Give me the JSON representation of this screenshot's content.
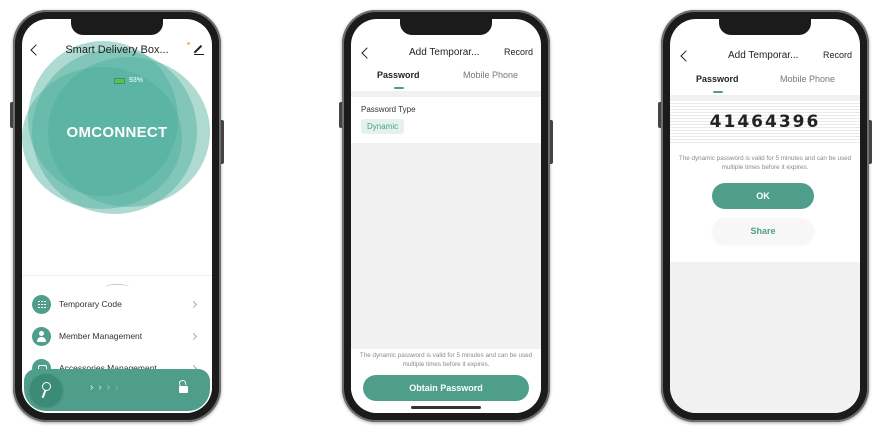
{
  "colors": {
    "accent": "#4f9e8c",
    "chip_bg": "#e4f1ed",
    "gray_bg": "#f1f1f1",
    "battery": "#58c23a"
  },
  "phone1": {
    "title": "Smart Delivery Box...",
    "battery_level": "93%",
    "brand": "OMCONNECT",
    "menu": [
      {
        "label": "Temporary Code",
        "icon": "keypad-icon"
      },
      {
        "label": "Member Management",
        "icon": "person-icon"
      },
      {
        "label": "Accessories Management",
        "icon": "accessory-icon"
      }
    ],
    "unlock_icon": "unlock-icon"
  },
  "phone2": {
    "title": "Add Temporar...",
    "record": "Record",
    "tabs": [
      "Password",
      "Mobile Phone"
    ],
    "password_type_label": "Password Type",
    "password_type_value": "Dynamic",
    "note": "The dynamic password is valid for 5 minutes and can be used multiple times before it expires.",
    "button": "Obtain Password"
  },
  "phone3": {
    "title": "Add Temporar...",
    "record": "Record",
    "tabs": [
      "Password",
      "Mobile Phone"
    ],
    "code": "41464396",
    "note": "The dynamic password is valid for 5 minutes and can be used multiple times before it expires.",
    "ok": "OK",
    "share": "Share"
  }
}
